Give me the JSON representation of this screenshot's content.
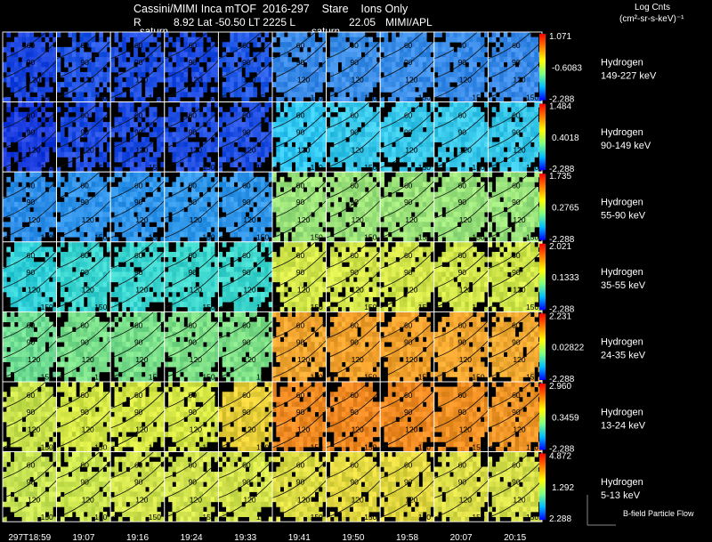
{
  "header": {
    "title_line": "Cassini/MIMI Inca mTOF  2016-297    Stare    Ions Only",
    "info_r": "R",
    "info_values": "8.92 Lat -50.50 LT 2225 L",
    "info_l": "22.05",
    "info_source": "MIMI/APL",
    "saturn_label_left": "saturn",
    "saturn_label_right": "saturn"
  },
  "units": {
    "line1": "Log Cnts",
    "line2": "(cm²-sr-s-keV)⁻¹"
  },
  "footer": {
    "bfield_label": "B-field Particle Flow"
  },
  "chart_data": {
    "type": "heatmap",
    "title": "Cassini/MIMI Inca mTOF  2016-297    Stare    Ions Only",
    "time_labels": [
      "297T18:59",
      "19:07",
      "19:16",
      "19:24",
      "19:33",
      "19:41",
      "19:50",
      "19:58",
      "20:07",
      "20:15"
    ],
    "contour_labels": [
      "60",
      "90",
      "120",
      "150"
    ],
    "colorbar_colors": [
      "#ff0000",
      "#ff8000",
      "#ffff00",
      "#80ff80",
      "#00c0ff",
      "#0000ff"
    ],
    "rows": [
      {
        "species": "Hydrogen",
        "energy": "149-227 keV",
        "max": "1.071",
        "mid": "-0.6083",
        "min": "-2.288",
        "frame_colors": [
          "#1b46e0",
          "#2155e6",
          "#2050e4",
          "#1e4ce3",
          "#2259e6",
          "#3a8ae8",
          "#3d8fe8",
          "#3b8ee9",
          "#3a8ce9",
          "#3a8ae8"
        ]
      },
      {
        "species": "Hydrogen",
        "energy": "90-149 keV",
        "max": "1.484",
        "mid": "0.4018",
        "min": "-2.288",
        "frame_colors": [
          "#1b3ddf",
          "#1f4ce3",
          "#1f4ce3",
          "#2250e4",
          "#2251e4",
          "#33c8f2",
          "#38c8ea",
          "#38c8ea",
          "#38c8ea",
          "#38c8ea"
        ]
      },
      {
        "species": "Hydrogen",
        "energy": "55-90 keV",
        "max": "1.735",
        "mid": "0.2765",
        "min": "-2.288",
        "frame_colors": [
          "#2e8ee8",
          "#2f93ea",
          "#2f94ea",
          "#3198ea",
          "#3297ea",
          "#9ae27a",
          "#9be27a",
          "#9be27a",
          "#99e27b",
          "#98e27b"
        ]
      },
      {
        "species": "Hydrogen",
        "energy": "35-55 keV",
        "max": "2.021",
        "mid": "0.1333",
        "min": "-2.288",
        "frame_colors": [
          "#33d0d8",
          "#3bd5d0",
          "#3bd5d0",
          "#3dd6cd",
          "#3dd6cd",
          "#d2e64a",
          "#d4e64a",
          "#d4e64a",
          "#d2e64a",
          "#d0e64a"
        ]
      },
      {
        "species": "Hydrogen",
        "energy": "24-35 keV",
        "max": "2.231",
        "mid": "0.02822",
        "min": "-2.288",
        "frame_colors": [
          "#6fdc92",
          "#78de8a",
          "#78de8a",
          "#7cde86",
          "#7cde86",
          "#f3a630",
          "#f4a22d",
          "#f4a22d",
          "#f3a630",
          "#f2aa32"
        ]
      },
      {
        "species": "Hydrogen",
        "energy": "13-24 keV",
        "max": "2.960",
        "mid": "0.3459",
        "min": "-2.288",
        "frame_colors": [
          "#c9e24c",
          "#d1e444",
          "#d5e644",
          "#d5e644",
          "#e7ce38",
          "#f08a22",
          "#f08822",
          "#f08a22",
          "#f09024",
          "#f09628"
        ]
      },
      {
        "species": "Hydrogen",
        "energy": "5-13 keV",
        "max": "4.872",
        "mid": "1.292",
        "min": "2.288",
        "frame_colors": [
          "#c8e454",
          "#cce650",
          "#d2e44e",
          "#d2e44e",
          "#d4e44c",
          "#dcdc44",
          "#e2d840",
          "#e2d840",
          "#dcde48",
          "#d6e04a"
        ]
      }
    ]
  }
}
